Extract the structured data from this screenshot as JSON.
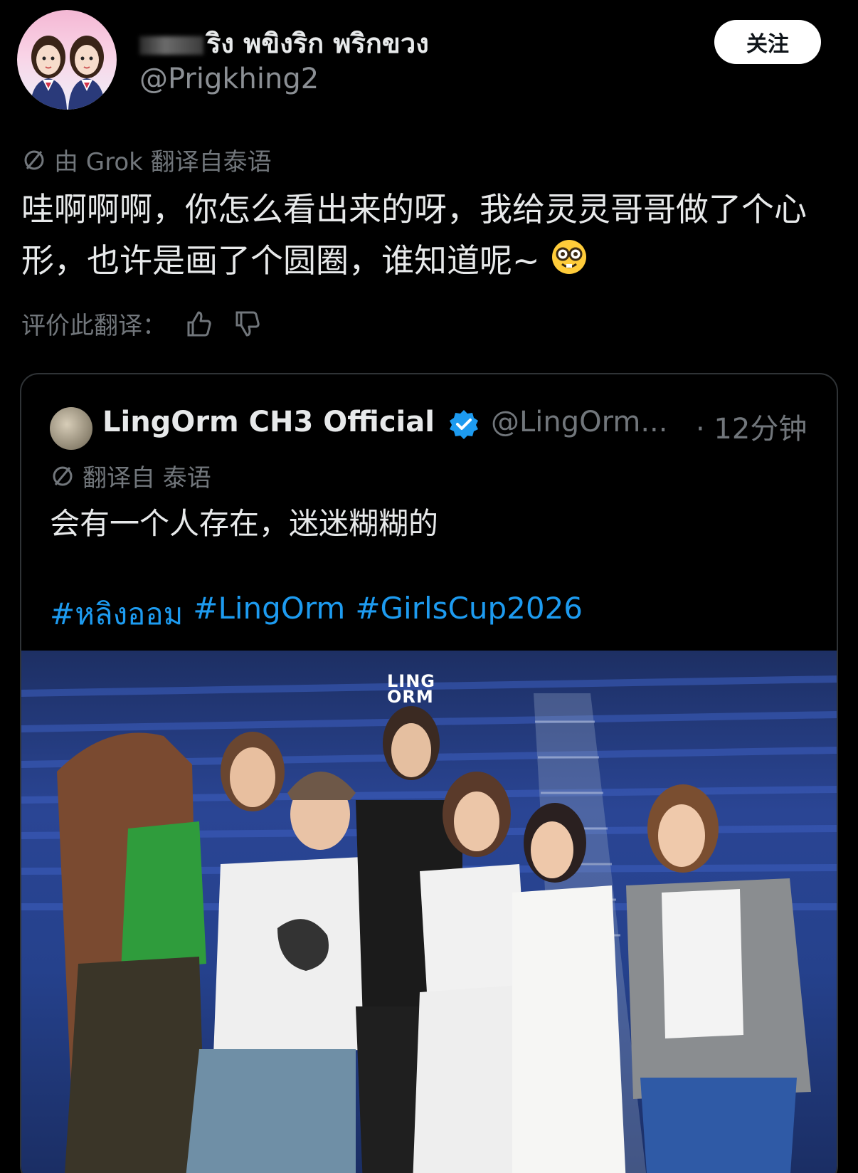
{
  "author": {
    "display_name": "ริง พขิงริก พริกขวง",
    "handle": "@Prigkhing2",
    "follow_label": "关注"
  },
  "translation_note": "由 Grok 翻译自泰语",
  "post_text": "哇啊啊啊，你怎么看出来的呀，我给灵灵哥哥做了个心形，也许是画了个圆圈，谁知道呢~",
  "rate_label": "评价此翻译：",
  "quote": {
    "name": "LingOrm CH3 Official",
    "handle": "@LingOrm...",
    "time": "· 12分钟",
    "translation_note": "翻译自 泰语",
    "text": "会有一个人存在，迷迷糊糊的",
    "hashtags": [
      "#หลิงออม",
      "#LingOrm",
      "#GirlsCup2026"
    ],
    "photo_logo_line1": "LING",
    "photo_logo_line2": "ORM"
  },
  "icons": {
    "translate": "translate-icon",
    "thumbs_up": "thumbs-up-icon",
    "thumbs_down": "thumbs-down-icon",
    "verified": "verified-badge-icon",
    "emoji": "nerd-face-emoji"
  },
  "colors": {
    "background": "#000000",
    "text": "#e7e9ea",
    "muted": "#71767b",
    "link": "#1d9bf0",
    "border": "#2f3336"
  }
}
